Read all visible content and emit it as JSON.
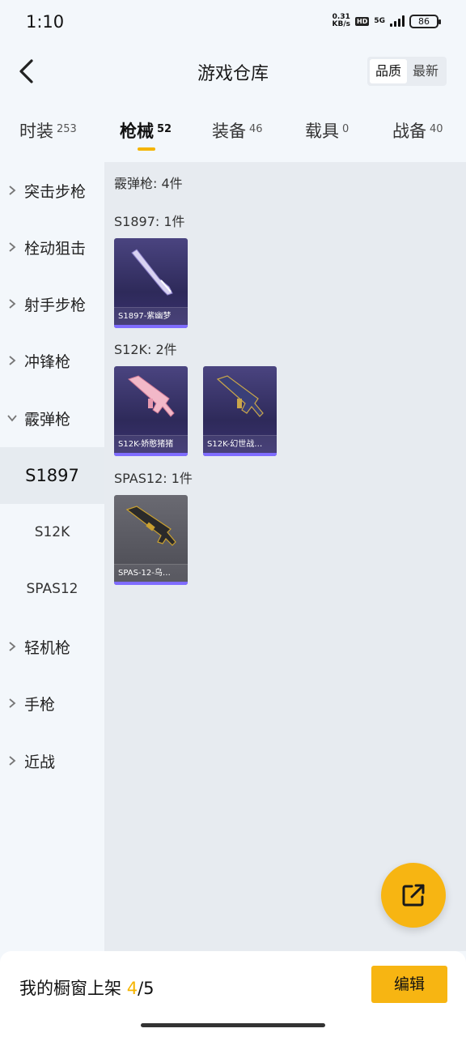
{
  "status_bar": {
    "time": "1:10",
    "net_speed": "0.31",
    "net_unit": "KB/s",
    "hd": "HD",
    "network": "5G",
    "battery": "86"
  },
  "header": {
    "title": "游戏仓库",
    "sort_options": [
      "品质",
      "最新"
    ]
  },
  "tabs": [
    {
      "label": "时装",
      "count": "253"
    },
    {
      "label": "枪械",
      "count": "52"
    },
    {
      "label": "装备",
      "count": "46"
    },
    {
      "label": "载具",
      "count": "0"
    },
    {
      "label": "战备",
      "count": "40"
    }
  ],
  "sidebar": {
    "categories": [
      "突击步枪",
      "栓动狙击",
      "射手步枪",
      "冲锋枪",
      "霰弹枪",
      "轻机枪",
      "手枪",
      "近战"
    ],
    "subcategories": [
      "S1897",
      "S12K",
      "SPAS12"
    ]
  },
  "content": {
    "section_title": "霰弹枪: 4件",
    "groups": [
      {
        "title": "S1897: 1件",
        "items": [
          {
            "name": "S1897-紫幽梦"
          }
        ]
      },
      {
        "title": "S12K: 2件",
        "items": [
          {
            "name": "S12K-娇憨猪猪"
          },
          {
            "name": "S12K-幻世战…"
          }
        ]
      },
      {
        "title": "SPAS12: 1件",
        "items": [
          {
            "name": "SPAS-12-乌…"
          }
        ]
      }
    ]
  },
  "bottom_bar": {
    "label": "我的橱窗上架",
    "current": "4",
    "total": "/5",
    "edit_label": "编辑"
  },
  "colors": {
    "accent": "#f5b400",
    "card_purple": "#3a3170",
    "rarity_bar": "#7f6cff"
  }
}
